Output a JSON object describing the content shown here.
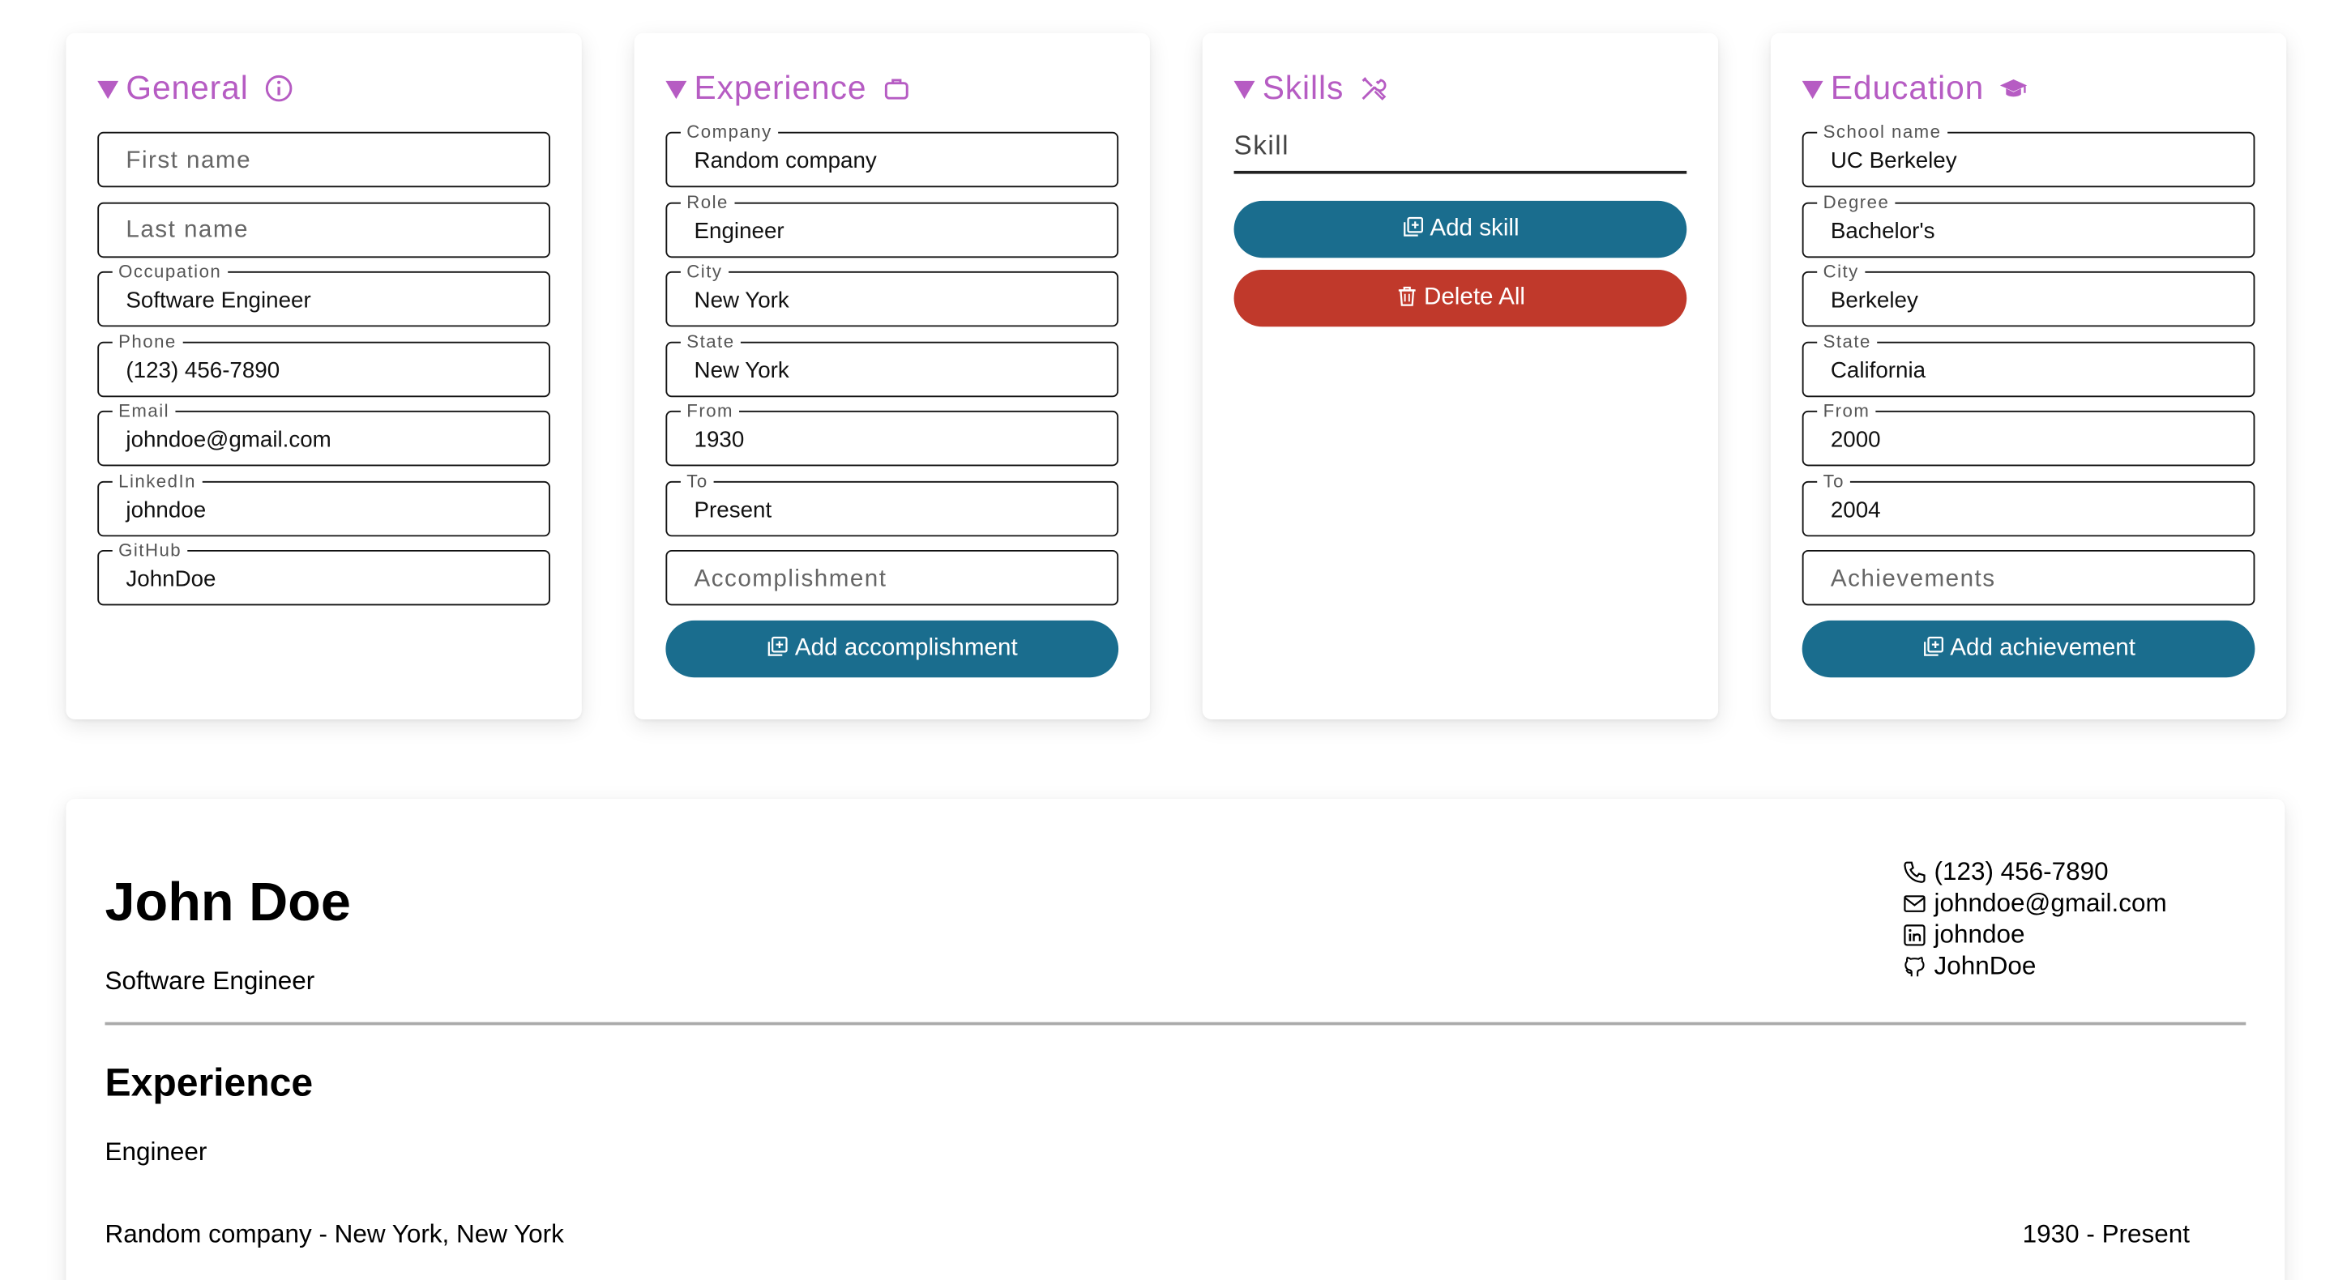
{
  "general": {
    "title": "General",
    "first_name_placeholder": "First name",
    "last_name_placeholder": "Last name",
    "fields": [
      {
        "label": "Occupation",
        "value": "Software Engineer"
      },
      {
        "label": "Phone",
        "value": "(123) 456-7890"
      },
      {
        "label": "Email",
        "value": "johndoe@gmail.com"
      },
      {
        "label": "LinkedIn",
        "value": "johndoe"
      },
      {
        "label": "GitHub",
        "value": "JohnDoe"
      }
    ]
  },
  "experience": {
    "title": "Experience",
    "fields": [
      {
        "label": "Company",
        "value": "Random company"
      },
      {
        "label": "Role",
        "value": "Engineer"
      },
      {
        "label": "City",
        "value": "New York"
      },
      {
        "label": "State",
        "value": "New York"
      },
      {
        "label": "From",
        "value": "1930"
      },
      {
        "label": "To",
        "value": "Present"
      }
    ],
    "accomplishment_placeholder": "Accomplishment",
    "add_button": "Add accomplishment"
  },
  "skills": {
    "title": "Skills",
    "input_placeholder": "Skill",
    "add_button": "Add skill",
    "delete_button": "Delete All"
  },
  "education": {
    "title": "Education",
    "fields": [
      {
        "label": "School name",
        "value": "UC Berkeley"
      },
      {
        "label": "Degree",
        "value": "Bachelor's"
      },
      {
        "label": "City",
        "value": "Berkeley"
      },
      {
        "label": "State",
        "value": "California"
      },
      {
        "label": "From",
        "value": "2000"
      },
      {
        "label": "To",
        "value": "2004"
      }
    ],
    "achievements_placeholder": "Achievements",
    "add_button": "Add achievement"
  },
  "resume": {
    "name": "John Doe",
    "occupation": "Software Engineer",
    "contact": {
      "phone": "(123) 456-7890",
      "email": "johndoe@gmail.com",
      "linkedin": "johndoe",
      "github": "JohnDoe"
    },
    "experience_heading": "Experience",
    "role": "Engineer",
    "company_line": "Random company - New York, New York",
    "dates": "1930 - Present"
  },
  "colors": {
    "accent": "#b65cc3",
    "primary_button": "#1a6d8e",
    "danger_button": "#c0392b"
  },
  "icons": {
    "general": "info-icon",
    "experience": "briefcase-icon",
    "skills": "tools-icon",
    "education": "graduation-cap-icon"
  }
}
